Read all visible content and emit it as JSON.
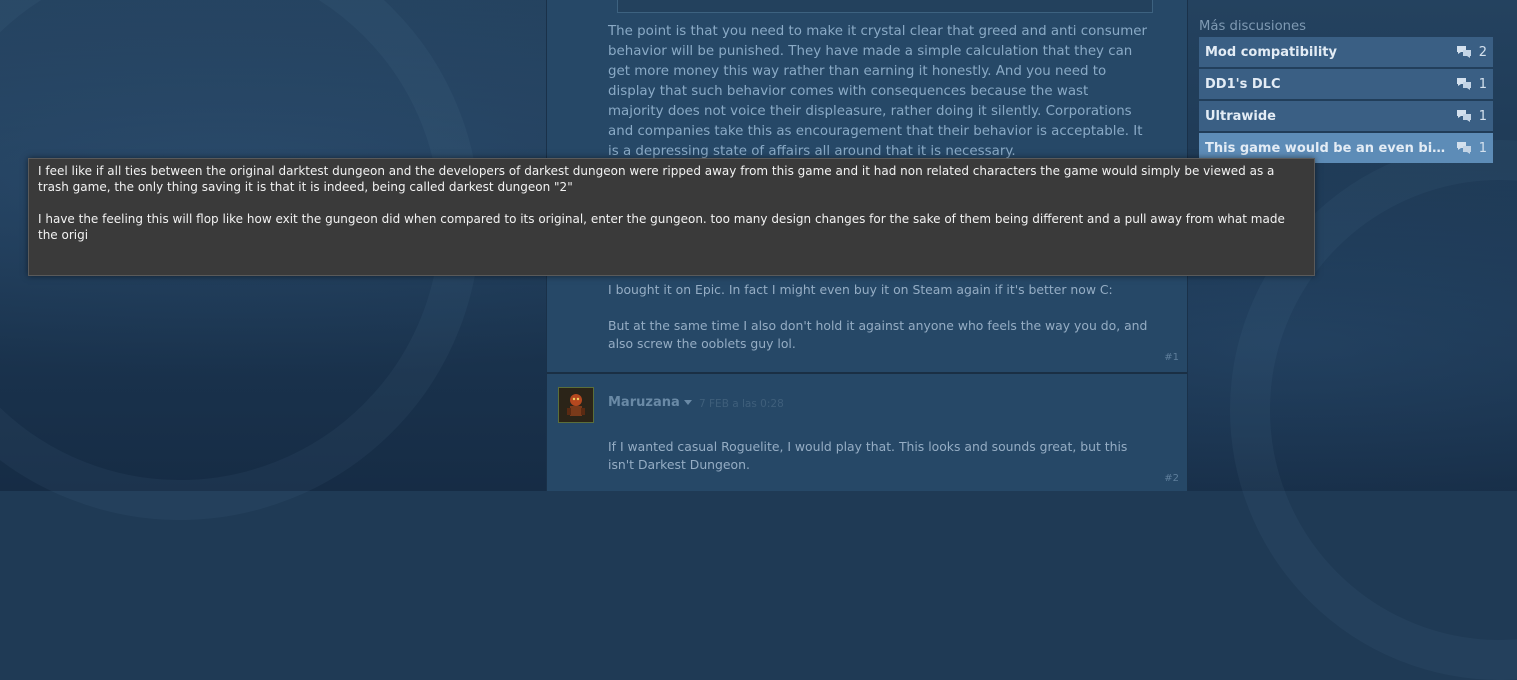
{
  "thread": {
    "main_post_text": "The point is that you need to make it crystal clear that greed and anti consumer behavior will be punished. They have made a simple calculation that they can get more money this way rather than earning it honestly. And you need to display that such behavior comes with consequences because the wast majority does not voice their displeasure, rather doing it silently. Corporations and companies take this as encouragement that their behavior is acceptable. It is a depressing state of affairs all around that it is necessary.",
    "reply1": {
      "line1": "I bought it on Epic. In fact I might even buy it on Steam again if it's better now C:",
      "line2": "But at the same time I also don't hold it against anyone who feels the way you do, and also screw the ooblets guy lol.",
      "number": "#1"
    },
    "reply2": {
      "author": "Maruzana",
      "timestamp": "7 FEB a las 0:28",
      "text": "If I wanted casual Roguelite, I would play that. This looks and sounds great, but this isn't Darkest Dungeon.",
      "number": "#2"
    }
  },
  "sidebar": {
    "title": "Más discusiones",
    "items": [
      {
        "label": "Mod compatibility",
        "count": "2",
        "icon": "comment-bubbles-icon"
      },
      {
        "label": "DD1's DLC",
        "count": "1",
        "icon": "comment-bubbles-icon"
      },
      {
        "label": "Ultrawide",
        "count": "1",
        "icon": "comment-bubbles-icon"
      },
      {
        "label": "This game would be an even bigge...",
        "count": "1",
        "icon": "comment-bubbles-icon"
      }
    ]
  },
  "tooltip": {
    "paragraph1": "I feel like if all ties between the original darktest dungeon and the developers of darkest dungeon were ripped away from this game and it had non related characters the game would simply be viewed as a trash game, the only thing saving it is that it is indeed, being called darkest dungeon \"2\"",
    "paragraph2": "I have the feeling this will flop like how exit the gungeon did when compared to its original, enter the gungeon. too many design changes for the sake of them being different and a pull away from what made the origi"
  },
  "colors": {
    "background": "#1f3a55",
    "thread_bg": "#264867",
    "sidebar_item": "#3a5f84",
    "sidebar_item_active": "#5d8cb7",
    "tooltip_bg": "#3a3a3a"
  }
}
